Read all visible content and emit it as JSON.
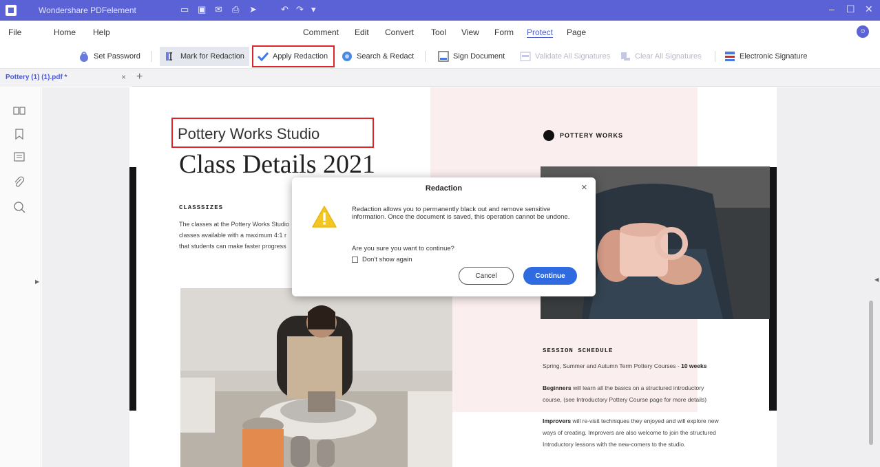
{
  "app": {
    "title": "Wondershare PDFelement",
    "quick_access_icons": [
      "folder-icon",
      "save-icon",
      "email-icon",
      "print-icon",
      "share-icon",
      "undo-icon",
      "redo-icon",
      "dropdown-icon"
    ],
    "window_controls": [
      "minimize-icon",
      "maximize-icon",
      "close-icon"
    ]
  },
  "menu": {
    "left": [
      "File",
      "Home",
      "Help"
    ],
    "center": [
      "Comment",
      "Edit",
      "Convert",
      "Tool",
      "View",
      "Form",
      "Protect",
      "Page"
    ],
    "active": "Protect"
  },
  "ribbon": {
    "set_password": "Set Password",
    "mark_for_redaction": "Mark for Redaction",
    "apply_redaction": "Apply Redaction",
    "search_redact": "Search & Redact",
    "sign_document": "Sign Document",
    "validate_all_signatures": "Validate All Signatures",
    "clear_all_signatures": "Clear All Signatures",
    "electronic_signature": "Electronic Signature"
  },
  "tabs": {
    "doc_name": "Pottery (1) (1).pdf *",
    "close": "×",
    "add": "+"
  },
  "document": {
    "studio_title": "Pottery Works Studio",
    "heading": "Class Details 2021",
    "class_sizes_heading": "CLASSSIZES",
    "class_sizes_lines": [
      "The classes at the Pottery Works Studio",
      "classes available with a maximum 4:1 r",
      "that students can make faster progress"
    ],
    "brand": "POTTERY WORKS",
    "session_schedule_heading": "SESSION SCHEDULE",
    "schedule_line_prefix": "Spring, Summer and Autumn Term Pottery Courses - ",
    "schedule_line_bold": "10 weeks",
    "beginners_bold": "Beginners",
    "beginners_line1": " will learn all the basics on a structured introductory",
    "beginners_line2": "course, (see Introductory Pottery Course page for more details)",
    "improvers_bold": "Improvers",
    "improvers_line1": " will re-visit techniques they enjoyed and will explore new",
    "improvers_line2": "ways of creating. Improvers are also welcome to join the structured",
    "improvers_line3": "Introductory lessons with the new-comers to the studio."
  },
  "dialog": {
    "title": "Redaction",
    "close": "×",
    "message": "Redaction allows you to permanently black out and remove sensitive information. Once the document is saved, this operation cannot be undone.",
    "confirm": "Are you sure you want to continue?",
    "checkbox_label": "Don't show again",
    "cancel": "Cancel",
    "continue": "Continue"
  },
  "colors": {
    "titlebar": "#5a62d6",
    "accent": "#4a5bd8",
    "highlight": "#d9262c",
    "continue_button": "#2f6ae0",
    "warning": "#f3c623"
  }
}
